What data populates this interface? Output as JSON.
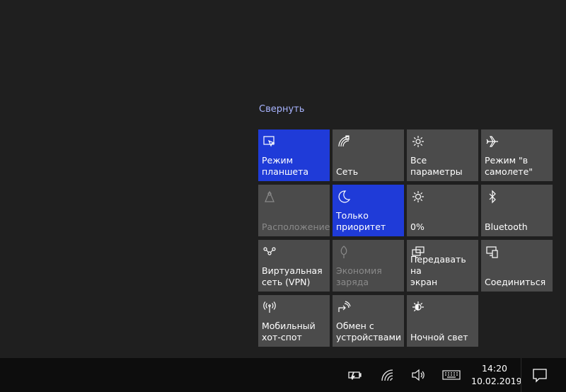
{
  "action_center": {
    "collapse_label": "Свернуть",
    "tiles": [
      {
        "label": "Режим\nпланшета",
        "state": "on",
        "icon": "tablet-mode-icon"
      },
      {
        "label": "Сеть",
        "state": "normal",
        "icon": "network-icon"
      },
      {
        "label": "Все параметры",
        "state": "normal",
        "icon": "gear-icon"
      },
      {
        "label": "Режим \"в\nсамолете\"",
        "state": "normal",
        "icon": "airplane-icon"
      },
      {
        "label": "Расположение",
        "state": "off",
        "icon": "location-icon"
      },
      {
        "label": "Только\nприоритет",
        "state": "on",
        "icon": "moon-icon"
      },
      {
        "label": "0%",
        "state": "normal",
        "icon": "brightness-icon"
      },
      {
        "label": "Bluetooth",
        "state": "normal",
        "icon": "bluetooth-icon"
      },
      {
        "label": "Виртуальная\nсеть (VPN)",
        "state": "normal",
        "icon": "vpn-icon"
      },
      {
        "label": "Экономия\nзаряда",
        "state": "off",
        "icon": "battery-saver-icon"
      },
      {
        "label": "Передавать на\nэкран",
        "state": "normal",
        "icon": "project-icon"
      },
      {
        "label": "Соединиться",
        "state": "normal",
        "icon": "connect-icon"
      },
      {
        "label": "Мобильный\nхот-спот",
        "state": "normal",
        "icon": "hotspot-icon"
      },
      {
        "label": "Обмен с\nустройствами",
        "state": "normal",
        "icon": "share-icon"
      },
      {
        "label": "Ночной свет",
        "state": "normal",
        "icon": "night-light-icon"
      }
    ]
  },
  "taskbar": {
    "time": "14:20",
    "date": "10.02.2019",
    "tray_icons": [
      "battery-icon",
      "wifi-icon",
      "volume-icon",
      "keyboard-icon"
    ],
    "action_center_icon": "notification-icon"
  },
  "colors": {
    "background": "#1f1f1f",
    "tile": "#4b4b4b",
    "tile_on": "#1f3bd8",
    "taskbar": "#0d0d0d",
    "link": "#a8b4ff"
  }
}
